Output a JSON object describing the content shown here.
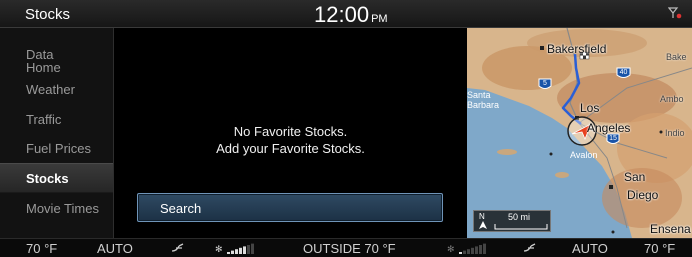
{
  "header": {
    "title": "Stocks",
    "time": "12:00",
    "ampm": "PM"
  },
  "sidebar": {
    "items": [
      {
        "label": "Data\nHome"
      },
      {
        "label": "Weather"
      },
      {
        "label": "Traffic"
      },
      {
        "label": "Fuel Prices"
      },
      {
        "label": "Stocks",
        "active": true
      },
      {
        "label": "Movie Times"
      }
    ]
  },
  "main": {
    "message_line1": "No Favorite Stocks.",
    "message_line2": "Add your Favorite Stocks.",
    "search_label": "Search"
  },
  "map": {
    "labels": {
      "bakersfield": "Bakersfield",
      "bake": "Bake",
      "los": "Los",
      "angeles": "Angeles",
      "ambo": "Ambo",
      "santa_barbara_1": "Santa",
      "santa_barbara_2": "Barbara",
      "indio": "Indio",
      "avalon": "Avalon",
      "san": "San",
      "diego": "Diego",
      "ensena": "Ensena"
    },
    "highways": [
      "5",
      "40",
      "15"
    ],
    "scale": {
      "north": "N",
      "distance": "50 mi"
    }
  },
  "climate": {
    "left_temp": "70 °F",
    "left_mode": "AUTO",
    "outside": "OUTSIDE  70 °F",
    "right_mode": "AUTO",
    "right_temp": "70 °F",
    "left_fan_level": 5,
    "right_fan_level": 1
  },
  "colors": {
    "accent_blue": "#6f94b8",
    "route_blue": "#2a5fd6",
    "signal_red": "#d33"
  }
}
